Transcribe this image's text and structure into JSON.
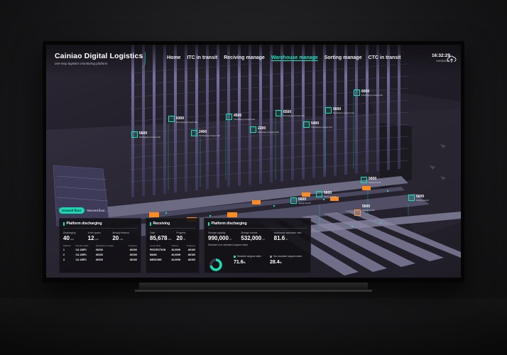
{
  "header": {
    "brand_title": "Cainiao Digital Logistics",
    "brand_subtitle": "one-stop logistics monitoring platform",
    "nav": [
      {
        "label": "Home",
        "active": false
      },
      {
        "label": "ITC in transit",
        "active": false
      },
      {
        "label": "Reciving manage",
        "active": false
      },
      {
        "label": "Warehouse manage",
        "active": true
      },
      {
        "label": "Sorting manage",
        "active": false
      },
      {
        "label": "CTC in transit",
        "active": false
      }
    ],
    "time": "16:32:29",
    "date": "19/08/2021"
  },
  "map_tags": [
    {
      "value": "6300",
      "sub": "Discharging conveyor belt",
      "icon": "up-icon"
    },
    {
      "value": "4500",
      "sub": "Discharging conveyor belt",
      "icon": "up-icon"
    },
    {
      "value": "6500",
      "sub": "Discharging conveyor belt",
      "icon": "up-icon"
    },
    {
      "value": "5600",
      "sub": "Discharging conveyor belt",
      "icon": "up-icon"
    },
    {
      "value": "6000",
      "sub": "Discharging conveyor belt",
      "icon": "up-icon"
    },
    {
      "value": "5600",
      "sub": "Discharging conveyor belt",
      "icon": "up-icon"
    },
    {
      "value": "2400",
      "sub": "Discharging conveyor belt",
      "icon": "up-icon"
    },
    {
      "value": "2200",
      "sub": "Discharging conveyor belt",
      "icon": "up-icon"
    },
    {
      "value": "5400",
      "sub": "Discharging conveyor belt",
      "icon": "up-icon"
    },
    {
      "value": "5600",
      "sub": "Sorting Line 01",
      "icon": "up-icon"
    },
    {
      "value": "5600",
      "sub": "Sorting Line 02",
      "icon": "up-icon"
    },
    {
      "value": "5600",
      "sub": "Sorting Line 03",
      "icon": "up-icon"
    },
    {
      "value": "5600",
      "sub": "Sorting Line 04",
      "icon": "up-icon"
    },
    {
      "value": "5600",
      "sub": "Sorting Line 05",
      "icon": "warning-icon"
    }
  ],
  "floors": {
    "active": "Ground floor",
    "other": "Second floor"
  },
  "panel1": {
    "title": "Platform discharging",
    "stats": [
      {
        "label": "Discharging",
        "value": "40",
        "unit": "unit"
      },
      {
        "label": "In the queue",
        "value": "12",
        "unit": "unit"
      },
      {
        "label": "Already finished",
        "value": "20",
        "unit": "unit"
      }
    ],
    "columns": [
      "Platform",
      "Number plate",
      "Quantities of cargo",
      "Progress"
    ],
    "rows": [
      [
        "1",
        "CA 135F1",
        "40/100",
        "40/100"
      ],
      [
        "2",
        "CA 135F1",
        "40/100",
        "40/100"
      ],
      [
        "3",
        "CA 135F1",
        "40/100",
        "40/100"
      ]
    ]
  },
  "panel2": {
    "title": "Receiving",
    "stats": [
      {
        "label": "Total",
        "value": "85,678",
        "unit": "unit"
      },
      {
        "label": "Progress",
        "value": "20",
        "unit": "%"
      }
    ],
    "columns": [
      "Commodity",
      "Volume",
      "Progress"
    ],
    "rows": [
      [
        "PROTECTION",
        "40,000ft",
        "40/100"
      ],
      [
        "MASK",
        "40,000ft",
        "40/100"
      ],
      [
        "MEDICINE",
        "40,000ft",
        "40/100"
      ]
    ]
  },
  "panel3": {
    "title": "Platform discharging",
    "stats": [
      {
        "label": "Storage capacity",
        "value": "990,000",
        "unit": "m³"
      },
      {
        "label": "Storage volume",
        "value": "532,000",
        "unit": "m³"
      },
      {
        "label": "warehouse saturation ratio",
        "value": "81.6",
        "unit": "%"
      }
    ],
    "ratio_label": "Standard /non standard cargoes ration",
    "standard_label": "Standard cargoes ration",
    "nonstandard_label": "Non standard cargoes ration",
    "standard_value": "71.6",
    "nonstandard_value": "28.4",
    "pct_unit": "%",
    "standard_fraction": 0.716
  },
  "colors": {
    "accent": "#18e0b7",
    "warning": "#ff9a3c",
    "cargo": "#ff8a1f",
    "rack": "#6f6a96"
  }
}
